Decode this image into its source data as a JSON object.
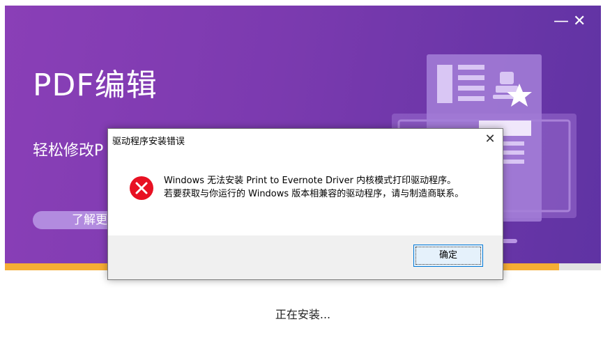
{
  "installer": {
    "title": "PDF编辑",
    "subtitle": "轻松修改P",
    "learn_more_label": "了解更",
    "minimize_symbol": "—",
    "close_symbol": "✕",
    "status_text": "正在安装...",
    "progress_fraction": 0.93,
    "progress_color": "#f6ad34",
    "banner_color": "#7b3aaf"
  },
  "dialog": {
    "title": "驱动程序安装错误",
    "close_symbol": "✕",
    "icon": "error-icon",
    "message_line1": "Windows 无法安装 Print to Evernote Driver 内核模式打印驱动程序。",
    "message_line2": "若要获取与你运行的 Windows 版本相兼容的驱动程序，请与制造商联系。",
    "ok_label": "确定",
    "error_color": "#e81123"
  }
}
